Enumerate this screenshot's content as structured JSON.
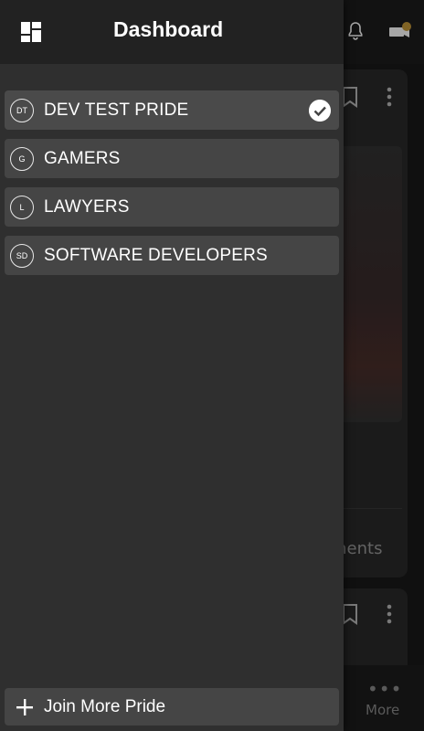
{
  "drawer": {
    "title": "Dashboard",
    "prides": [
      {
        "initials": "DT",
        "name": "DEV TEST PRIDE",
        "selected": true
      },
      {
        "initials": "G",
        "name": "GAMERS",
        "selected": false
      },
      {
        "initials": "L",
        "name": "LAWYERS",
        "selected": false
      },
      {
        "initials": "SD",
        "name": "SOFTWARE DEVELOPERS",
        "selected": false
      }
    ],
    "join_label": "Join More Pride"
  },
  "background": {
    "comments_label_partial": "ments",
    "bottom_nav_more_label": "More"
  },
  "colors": {
    "drawer_bg": "#2f2f2f",
    "item_bg": "#454545",
    "header_bg": "#222222",
    "notification_dot": "#c79a3a"
  },
  "icons": [
    "dashboard-icon",
    "bell-icon",
    "camera-icon",
    "bookmark-icon",
    "more-vertical-icon",
    "more-horizontal-icon",
    "checkmark-icon",
    "plus-icon"
  ]
}
